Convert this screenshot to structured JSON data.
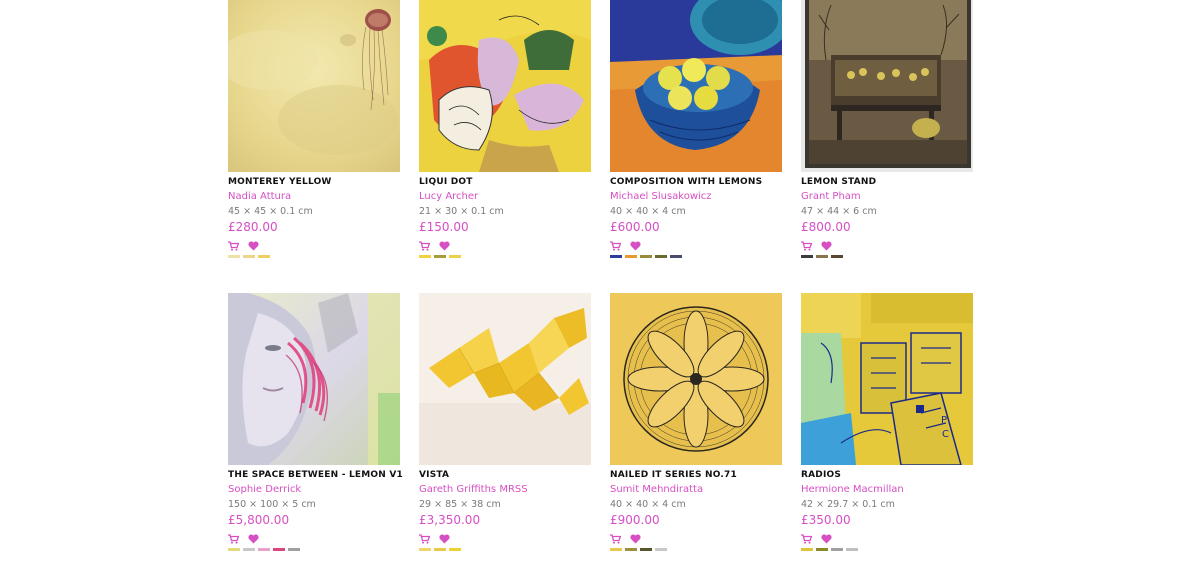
{
  "artworks": [
    {
      "title": "MONTEREY YELLOW",
      "artist": "Nadia Attura",
      "dimensions": "45 × 45 × 0.1 cm",
      "price": "£280.00",
      "swatches": [
        "#ede2a6",
        "#ecd68a",
        "#eed061"
      ]
    },
    {
      "title": "LIQUI DOT",
      "artist": "Lucy Archer",
      "dimensions": "21 × 30 × 0.1 cm",
      "price": "£150.00",
      "swatches": [
        "#f0d23a",
        "#a59c3a",
        "#e8d24a"
      ]
    },
    {
      "title": "COMPOSITION WITH LEMONS",
      "artist": "Michael Slusakowicz",
      "dimensions": "40 × 40 × 4 cm",
      "price": "£600.00",
      "swatches": [
        "#2d3a9e",
        "#e69a2f",
        "#9a8a3c",
        "#6b6a2e",
        "#4a4c6c"
      ]
    },
    {
      "title": "LEMON STAND",
      "artist": "Grant Pham",
      "dimensions": "47 × 44 × 6 cm",
      "price": "£800.00",
      "swatches": [
        "#3c3a3a",
        "#8a7350",
        "#5a4630"
      ]
    },
    {
      "title": "THE SPACE BETWEEN - LEMON V1",
      "artist": "Sophie Derrick",
      "dimensions": "150 × 100 × 5 cm",
      "price": "£5,800.00",
      "swatches": [
        "#e5d97e",
        "#c8c8c8",
        "#e9a3c9",
        "#d8457f",
        "#a0a0a0"
      ]
    },
    {
      "title": "VISTA",
      "artist": "Gareth Griffiths MRSS",
      "dimensions": "29 × 85 × 38 cm",
      "price": "£3,350.00",
      "swatches": [
        "#f2d36a",
        "#e8c94a",
        "#f0d030"
      ]
    },
    {
      "title": "NAILED IT SERIES NO.71",
      "artist": "Sumit Mehndiratta",
      "dimensions": "40 × 40 × 4 cm",
      "price": "£900.00",
      "swatches": [
        "#e8c84e",
        "#9a9040",
        "#58542e",
        "#c8c8c8"
      ]
    },
    {
      "title": "RADIOS",
      "artist": "Hermione Macmillan",
      "dimensions": "42 × 29.7 × 0.1 cm",
      "price": "£350.00",
      "swatches": [
        "#e0c43a",
        "#8a8a2a",
        "#a0a0a0",
        "#c0c0c0"
      ]
    }
  ],
  "icons": {
    "cart": "cart-icon",
    "favorite": "heart-icon"
  },
  "colors": {
    "accent": "#d64fc3",
    "title": "#111111",
    "dimensions": "#7a7a7a"
  }
}
